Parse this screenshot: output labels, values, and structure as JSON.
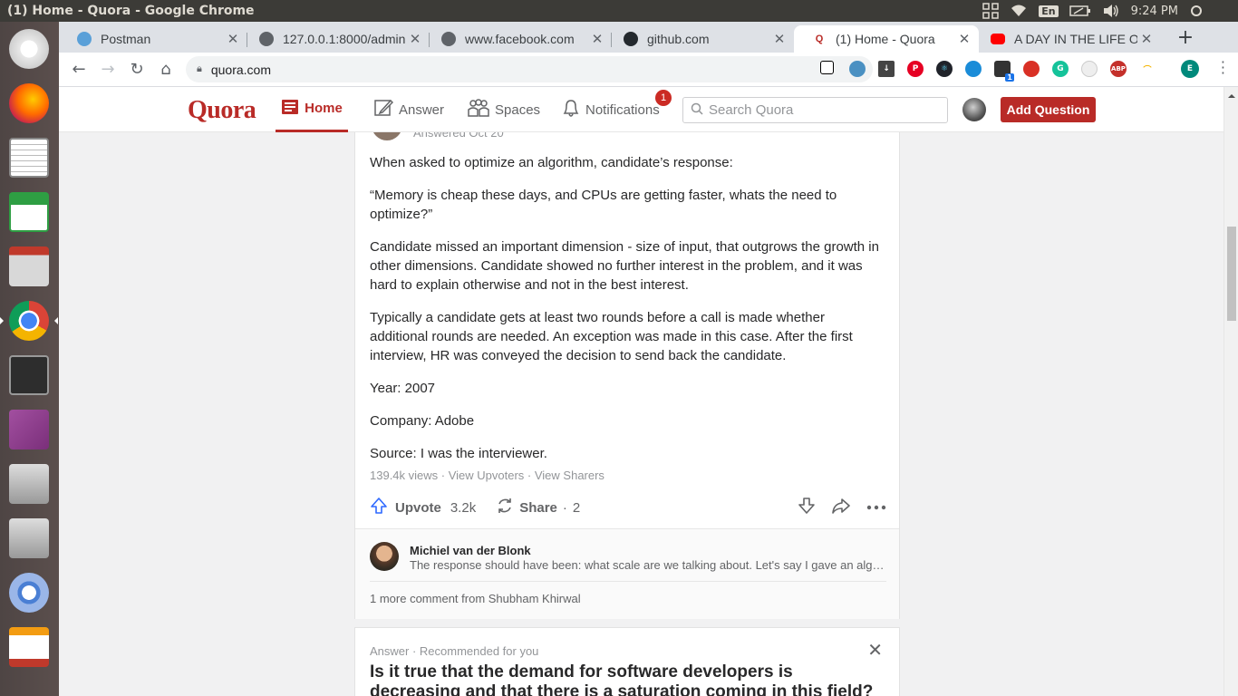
{
  "system": {
    "window_title": "(1) Home - Quora - Google Chrome",
    "keyboard_layout": "En",
    "clock": "9:24 PM"
  },
  "launcher": {
    "apps": [
      "ubuntu-dash",
      "firefox",
      "text-editor",
      "spreadsheet",
      "file-manager",
      "chrome",
      "terminal",
      "app-center",
      "drive-1",
      "drive-2",
      "chromium",
      "impress"
    ]
  },
  "browser": {
    "tabs": [
      {
        "title": "Postman",
        "icon": "postman-icon"
      },
      {
        "title": "127.0.0.1:8000/admin",
        "icon": "globe-icon"
      },
      {
        "title": "www.facebook.com",
        "icon": "globe-icon"
      },
      {
        "title": "github.com",
        "icon": "github-icon"
      },
      {
        "title": "(1) Home - Quora",
        "icon": "quora-icon",
        "active": true
      },
      {
        "title": "A DAY IN THE LIFE O",
        "icon": "youtube-icon"
      }
    ],
    "url": "quora.com",
    "profile_initial": "E",
    "ext_badge": "1"
  },
  "quora": {
    "logo": "Quora",
    "nav": {
      "home": "Home",
      "answer": "Answer",
      "spaces": "Spaces",
      "notifications": "Notifications",
      "notifications_count": "1"
    },
    "search_placeholder": "Search Quora",
    "add_question": "Add Question",
    "accent": "#b92b27"
  },
  "answer": {
    "answered_date": "Answered Oct 20",
    "paragraphs": [
      "When asked to optimize an algorithm, candidate’s response:",
      "“Memory is cheap these days, and CPUs are getting faster, whats the need to optimize?”",
      "Candidate missed an important dimension - size of input, that outgrows the growth in other dimensions. Candidate showed no further interest in the problem, and it was hard to explain otherwise and not in the best interest.",
      "Typically a candidate gets at least two rounds before a call is made whether additional rounds are needed. An exception was made in this case. After the first interview, HR was conveyed the decision to send back the candidate.",
      "Year: 2007",
      "Company: Adobe",
      "Source: I was the interviewer."
    ],
    "views": "139.4k views",
    "view_upvoters": "View Upvoters",
    "view_sharers": "View Sharers",
    "upvote_label": "Upvote",
    "upvote_count": "3.2k",
    "share_label": "Share",
    "share_count": "2",
    "comment": {
      "author": "Michiel van der Blonk",
      "text": "The response should have been: what scale are we talking about. Let's say I gave an algorithm that..."
    },
    "more_comments": "1 more comment from Shubham Khirwal"
  },
  "recommended": {
    "label": "Answer · Recommended for you",
    "question": "Is it true that the demand for software developers is decreasing and that there is a saturation coming in this field?"
  }
}
